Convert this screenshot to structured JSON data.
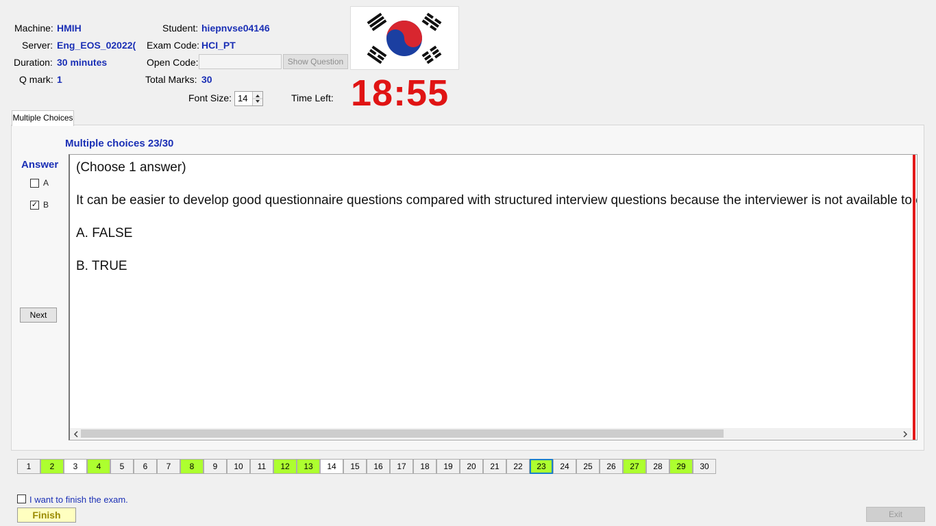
{
  "info": {
    "machine_label": "Machine:",
    "machine_value": "HMIH",
    "server_label": "Server:",
    "server_value": "Eng_EOS_02022(",
    "duration_label": "Duration:",
    "duration_value": "30 minutes",
    "qmark_label": "Q mark:",
    "qmark_value": "1",
    "student_label": "Student:",
    "student_value": "hiepnvse04146",
    "examcode_label": "Exam Code:",
    "examcode_value": "HCI_PT",
    "opencode_label": "Open Code:",
    "opencode_value": "",
    "show_question_label": "Show Question",
    "totalmarks_label": "Total Marks:",
    "totalmarks_value": "30",
    "fontsize_label": "Font Size:",
    "fontsize_value": "14",
    "timeleft_label": "Time Left:",
    "timer_value": "18:55"
  },
  "tab": {
    "label": "Multiple Choices"
  },
  "question": {
    "header": "Multiple choices 23/30",
    "instruction": "(Choose 1 answer)",
    "text": "It can be easier to develop good questionnaire questions compared with structured interview questions because the interviewer is not available to e",
    "options": [
      "A.  FALSE",
      "B.  TRUE"
    ]
  },
  "answer": {
    "title": "Answer",
    "choices": [
      {
        "label": "A",
        "checked": false,
        "mark": ""
      },
      {
        "label": "B",
        "checked": true,
        "mark": "✓"
      }
    ],
    "next_label": "Next"
  },
  "nav": {
    "buttons": [
      {
        "n": "1",
        "state": "normal"
      },
      {
        "n": "2",
        "state": "answered"
      },
      {
        "n": "3",
        "state": "white"
      },
      {
        "n": "4",
        "state": "answered"
      },
      {
        "n": "5",
        "state": "normal"
      },
      {
        "n": "6",
        "state": "normal"
      },
      {
        "n": "7",
        "state": "normal"
      },
      {
        "n": "8",
        "state": "answered"
      },
      {
        "n": "9",
        "state": "normal"
      },
      {
        "n": "10",
        "state": "normal"
      },
      {
        "n": "11",
        "state": "normal"
      },
      {
        "n": "12",
        "state": "answered"
      },
      {
        "n": "13",
        "state": "answered"
      },
      {
        "n": "14",
        "state": "white"
      },
      {
        "n": "15",
        "state": "normal"
      },
      {
        "n": "16",
        "state": "normal"
      },
      {
        "n": "17",
        "state": "normal"
      },
      {
        "n": "18",
        "state": "normal"
      },
      {
        "n": "19",
        "state": "normal"
      },
      {
        "n": "20",
        "state": "normal"
      },
      {
        "n": "21",
        "state": "normal"
      },
      {
        "n": "22",
        "state": "normal"
      },
      {
        "n": "23",
        "state": "current"
      },
      {
        "n": "24",
        "state": "normal"
      },
      {
        "n": "25",
        "state": "normal"
      },
      {
        "n": "26",
        "state": "normal"
      },
      {
        "n": "27",
        "state": "answered"
      },
      {
        "n": "28",
        "state": "normal"
      },
      {
        "n": "29",
        "state": "answered"
      },
      {
        "n": "30",
        "state": "normal"
      }
    ]
  },
  "footer": {
    "finish_check_label": "I want to finish the exam.",
    "finish_label": "Finish",
    "exit_label": "Exit"
  },
  "colors": {
    "accent": "#1a2fb5",
    "timer": "#e01414",
    "answered": "#adff2f",
    "scroll_marker": "#e31a1a"
  },
  "icons": {
    "flag": "korea-flag-image",
    "spinner": "spin-updown-icon",
    "scroll_left": "chevron-left-icon",
    "scroll_right": "chevron-right-icon"
  }
}
